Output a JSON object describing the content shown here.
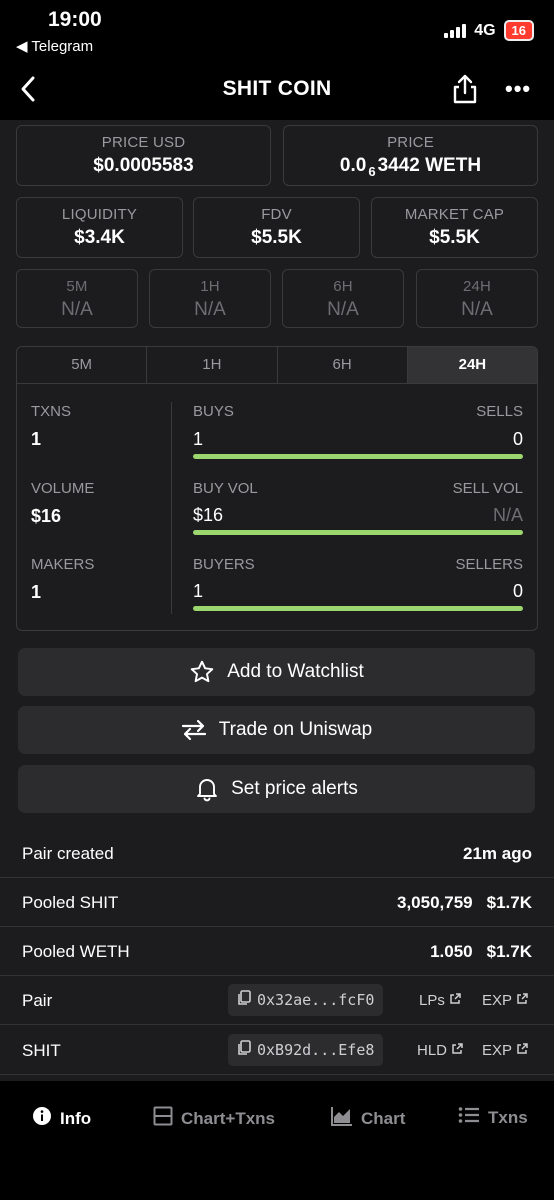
{
  "status_bar": {
    "time": "19:00",
    "back_app": "◀ Telegram",
    "network": "4G",
    "battery": "16"
  },
  "header": {
    "title": "SHIT COIN",
    "back_icon": "chevron-left-icon",
    "share_icon": "share-icon",
    "more_icon": "more-icon"
  },
  "prices": {
    "usd_label": "PRICE USD",
    "usd_value": "$0.0005583",
    "native_label": "PRICE",
    "native_prefix": "0.0",
    "native_sub": "6",
    "native_suffix": "3442 WETH"
  },
  "metrics": [
    {
      "label": "LIQUIDITY",
      "value": "$3.4K"
    },
    {
      "label": "FDV",
      "value": "$5.5K"
    },
    {
      "label": "MARKET CAP",
      "value": "$5.5K"
    }
  ],
  "changes": [
    {
      "label": "5M",
      "value": "N/A"
    },
    {
      "label": "1H",
      "value": "N/A"
    },
    {
      "label": "6H",
      "value": "N/A"
    },
    {
      "label": "24H",
      "value": "N/A"
    }
  ],
  "txn_panel": {
    "tabs": [
      "5M",
      "1H",
      "6H",
      "24H"
    ],
    "active_tab": "24H",
    "txns_label": "TXNS",
    "txns_value": "1",
    "volume_label": "VOLUME",
    "volume_value": "$16",
    "makers_label": "MAKERS",
    "makers_value": "1",
    "buys_label": "BUYS",
    "buys_value": "1",
    "sells_label": "SELLS",
    "sells_value": "0",
    "buy_vol_label": "BUY VOL",
    "buy_vol_value": "$16",
    "sell_vol_label": "SELL VOL",
    "sell_vol_value": "N/A",
    "buyers_label": "BUYERS",
    "buyers_value": "1",
    "sellers_label": "SELLERS",
    "sellers_value": "0",
    "bar_color": "#9cd66f"
  },
  "actions": {
    "watchlist": "Add to Watchlist",
    "trade": "Trade on Uniswap",
    "alerts": "Set price alerts"
  },
  "info": {
    "pair_created_label": "Pair created",
    "pair_created_value": "21m ago",
    "pooled_base_label": "Pooled SHIT",
    "pooled_base_amount": "3,050,759",
    "pooled_base_usd": "$1.7K",
    "pooled_quote_label": "Pooled WETH",
    "pooled_quote_amount": "1.050",
    "pooled_quote_usd": "$1.7K",
    "pair_label": "Pair",
    "pair_address": "0x32ae...fcF0",
    "pair_link1": "LPs",
    "pair_link2": "EXP",
    "token_label": "SHIT",
    "token_address": "0xB92d...Efe8",
    "token_link1": "HLD",
    "token_link2": "EXP"
  },
  "bottom_nav": {
    "items": [
      "Info",
      "Chart+Txns",
      "Chart",
      "Txns"
    ],
    "active": "Info"
  }
}
